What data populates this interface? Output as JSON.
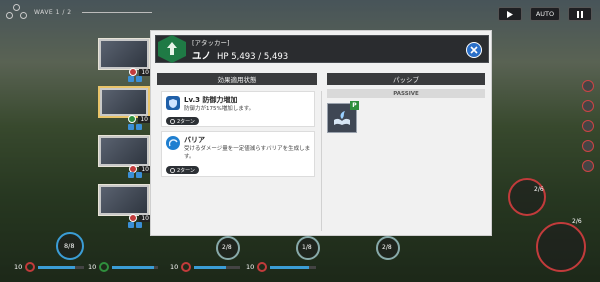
{
  "hud": {
    "wave": "WAVE 1 / 2",
    "auto_label": "AUTO"
  },
  "modal": {
    "role": "[アタッカー]",
    "name": "ユノ",
    "hp": "HP 5,493 / 5,493",
    "effects_header": "効果適用状態",
    "passive_header": "パッシブ",
    "passive_sub": "PASSIVE",
    "passive_badge": "P",
    "effects": [
      {
        "title": "Lv.3 防御力増加",
        "desc": "防御力が175%増加します。",
        "turns": "2ターン"
      },
      {
        "title": "バリア",
        "desc": "受けるダメージ量を一定値減らすバリアを生成します。",
        "turns": "2ターン"
      }
    ]
  },
  "party": [
    {
      "level": "10"
    },
    {
      "level": "10"
    },
    {
      "level": "10"
    },
    {
      "level": "10"
    }
  ],
  "bottom": {
    "stats": [
      "10",
      "10",
      "10",
      "10"
    ],
    "skill_counts": [
      "8/8",
      "2/8",
      "1/8",
      "2/8",
      "2/6",
      "2/6"
    ]
  },
  "colors": {
    "header_bg": "#2a2c2f",
    "class_green": "#1f7a45",
    "close_blue": "#2a6fc8",
    "effect_blue": "#1f5fa8"
  }
}
